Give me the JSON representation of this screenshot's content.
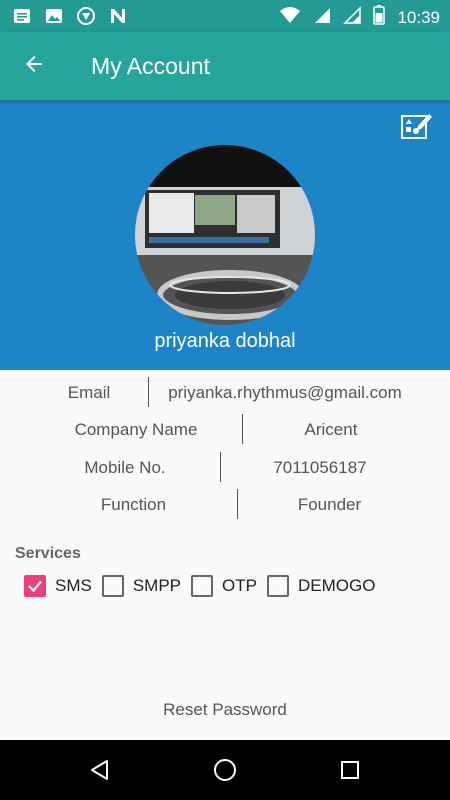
{
  "status_bar": {
    "time": "10:39",
    "left_icons": [
      "message-icon",
      "image-icon",
      "vpn-icon",
      "n-icon"
    ],
    "right_icons": [
      "wifi-icon",
      "cellular-signal-icon",
      "cellular-signal-icon",
      "battery-icon"
    ]
  },
  "app_bar": {
    "title": "My Account",
    "back_icon": "arrow-back-icon",
    "color": "#26a69a"
  },
  "profile": {
    "name": "priyanka dobhal",
    "header_color": "#1e84c8",
    "edit_icon": "edit-profile-icon"
  },
  "details": [
    {
      "label": "Email",
      "value": "priyanka.rhythmus@gmail.com"
    },
    {
      "label": "Company Name",
      "value": "Aricent"
    },
    {
      "label": "Mobile No.",
      "value": "7011056187"
    },
    {
      "label": "Function",
      "value": "Founder"
    }
  ],
  "services": {
    "title": "Services",
    "items": [
      {
        "label": "SMS",
        "checked": true
      },
      {
        "label": "SMPP",
        "checked": false
      },
      {
        "label": "OTP",
        "checked": false
      },
      {
        "label": "DEMOGO",
        "checked": false
      }
    ],
    "accent_color": "#ec407a"
  },
  "reset_password": "Reset Password",
  "nav_bar": {
    "icons": [
      "back-triangle-icon",
      "home-circle-icon",
      "recents-square-icon"
    ]
  }
}
